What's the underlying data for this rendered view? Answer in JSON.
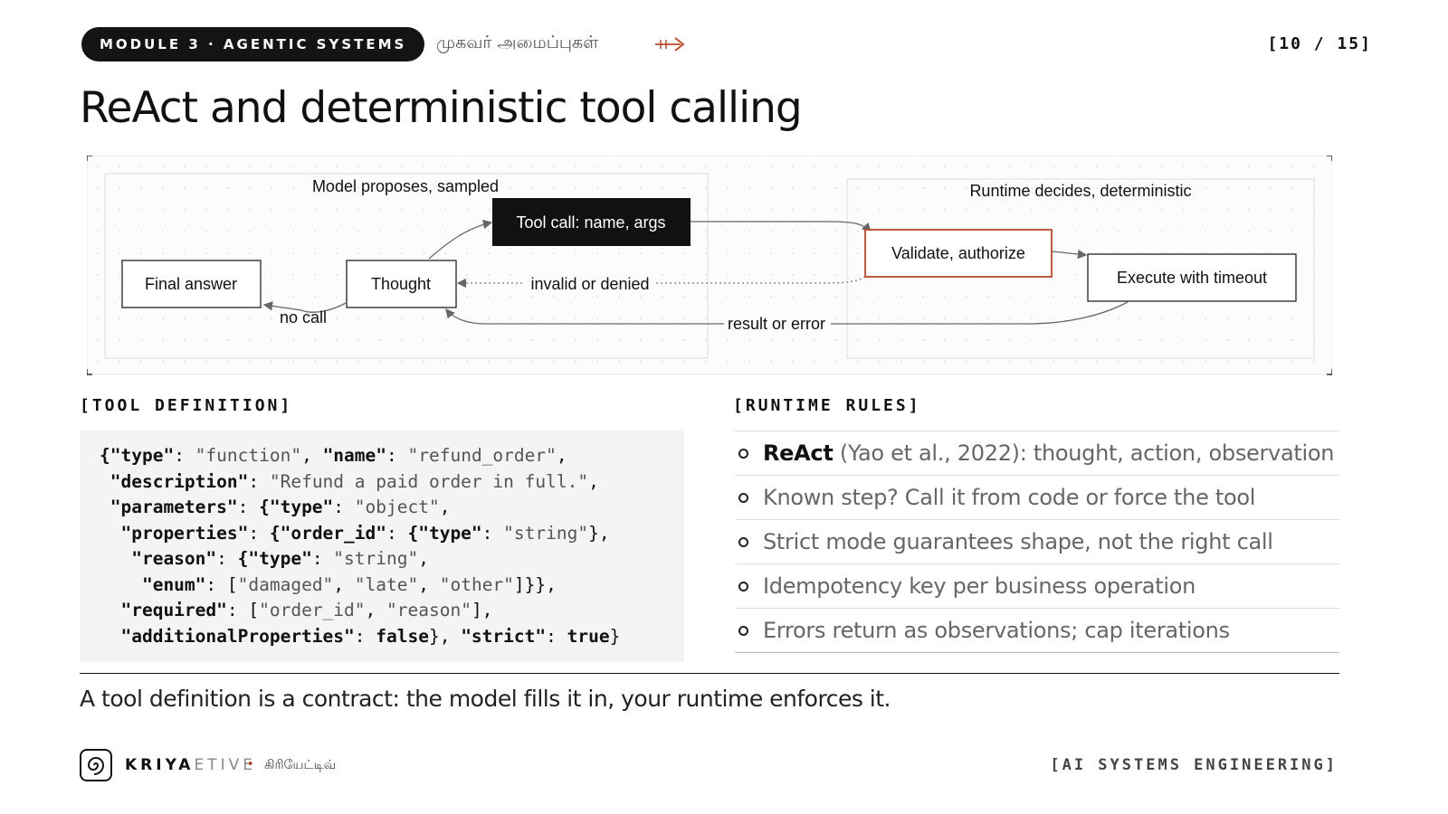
{
  "header": {
    "module": "MODULE 3 · AGENTIC SYSTEMS",
    "module_tamil": "முகவர் அமைப்புகள்",
    "arrow_icon": "wave-arrow-icon",
    "page_counter": "[10 / 15]",
    "accent_color": "#b84a2a"
  },
  "title": "ReAct and deterministic tool calling",
  "diagram": {
    "group_left_label": "Model proposes, sampled",
    "group_right_label": "Runtime decides, deterministic",
    "nodes": {
      "tool_call": "Tool call: name, args",
      "final_answer": "Final answer",
      "thought": "Thought",
      "validate": "Validate, authorize",
      "execute": "Execute with timeout"
    },
    "edges": {
      "no_call": "no call",
      "invalid": "invalid or denied",
      "result": "result or error"
    }
  },
  "tool_definition": {
    "label": "[TOOL DEFINITION]",
    "code": {
      "l1_k1": "{\"type\"",
      "l1_v1": "\"function\"",
      "l1_k2": "\"name\"",
      "l1_v2": "\"refund_order\"",
      "l2_k": " \"description\"",
      "l2_v": "\"Refund a paid order in full.\"",
      "l3_k": " \"parameters\"",
      "l3_k2": "{\"type\"",
      "l3_v": "\"object\"",
      "l4_k": "  \"properties\"",
      "l4_k2": "{\"order_id\"",
      "l4_k3": "{\"type\"",
      "l4_v": "\"string\"",
      "l5_k": "   \"reason\"",
      "l5_k2": "{\"type\"",
      "l5_v": "\"string\"",
      "l6_k": "    \"enum\"",
      "l6_v1": "\"damaged\"",
      "l6_v2": "\"late\"",
      "l6_v3": "\"other\"",
      "l7_k": "  \"required\"",
      "l7_v1": "\"order_id\"",
      "l7_v2": "\"reason\"",
      "l8_k": "  \"additionalProperties\"",
      "l8_v": "false",
      "l8_k2": "\"strict\"",
      "l8_v2": "true"
    }
  },
  "runtime_rules": {
    "label": "[RUNTIME RULES]",
    "items": [
      {
        "strong": "ReAct",
        "text": " (Yao et al., 2022): thought, action, observation"
      },
      {
        "strong": "",
        "text": "Known step? Call it from code or force the tool"
      },
      {
        "strong": "",
        "text": "Strict mode guarantees shape, not the right call"
      },
      {
        "strong": "",
        "text": "Idempotency key per business operation"
      },
      {
        "strong": "",
        "text": "Errors return as observations; cap iterations"
      }
    ]
  },
  "caption": "A tool definition is a contract: the model fills it in, your runtime enforces it.",
  "footer": {
    "logo_icon": "spiral-logo-icon",
    "brand_strong": "KRIYA",
    "brand_light": "ETIVE",
    "brand_dot": "•",
    "brand_tamil": "கிரியேட்டிவ்",
    "tag": "[AI SYSTEMS ENGINEERING]"
  }
}
